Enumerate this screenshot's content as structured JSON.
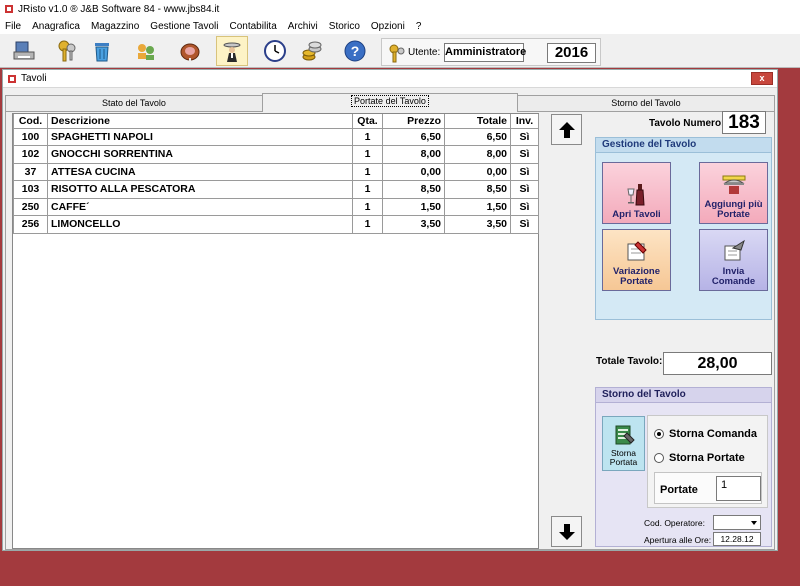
{
  "app": {
    "title": "JRisto v1.0 ® J&B Software 84 - www.jbs84.it"
  },
  "menu": [
    "File",
    "Anagrafica",
    "Magazzino",
    "Gestione Tavoli",
    "Contabilita",
    "Archivi",
    "Storico",
    "Opzioni",
    "?"
  ],
  "toolbar": {
    "icons": [
      "print-settings-icon",
      "keys-icon",
      "trash-icon",
      "people-icon",
      "ham-icon",
      "waiter-icon",
      "clock-icon",
      "coins-icon",
      "help-icon"
    ],
    "active_index": 5
  },
  "user": {
    "label": "Utente:",
    "name": "Amministratore",
    "year": "2016"
  },
  "window": {
    "title": "Tavoli",
    "close": "x"
  },
  "tabs": [
    {
      "label": "Stato del Tavolo",
      "selected": false
    },
    {
      "label": "Portate del Tavolo",
      "selected": true
    },
    {
      "label": "Storno del Tavolo",
      "selected": false
    }
  ],
  "table": {
    "headers": {
      "cod": "Cod.",
      "desc": "Descrizione",
      "qta": "Qta.",
      "prezzo": "Prezzo",
      "totale": "Totale",
      "inv": "Inv."
    },
    "rows": [
      {
        "cod": "100",
        "desc": "SPAGHETTI NAPOLI",
        "qta": "1",
        "prezzo": "6,50",
        "totale": "6,50",
        "inv": "Sì"
      },
      {
        "cod": "102",
        "desc": "GNOCCHI SORRENTINA",
        "qta": "1",
        "prezzo": "8,00",
        "totale": "8,00",
        "inv": "Sì"
      },
      {
        "cod": "37",
        "desc": "ATTESA CUCINA",
        "qta": "1",
        "prezzo": "0,00",
        "totale": "0,00",
        "inv": "Sì"
      },
      {
        "cod": "103",
        "desc": "RISOTTO ALLA PESCATORA",
        "qta": "1",
        "prezzo": "8,50",
        "totale": "8,50",
        "inv": "Sì"
      },
      {
        "cod": "250",
        "desc": "CAFFE´",
        "qta": "1",
        "prezzo": "1,50",
        "totale": "1,50",
        "inv": "Sì"
      },
      {
        "cod": "256",
        "desc": "LIMONCELLO",
        "qta": "1",
        "prezzo": "3,50",
        "totale": "3,50",
        "inv": "Sì"
      }
    ]
  },
  "tavolo": {
    "label": "Tavolo Numero:",
    "number": "183"
  },
  "gestione": {
    "title": "Gestione del Tavolo",
    "apri": "Apri Tavoli",
    "aggiungi": "Aggiungi più Portate",
    "variazione": "Variazione Portate",
    "invia": "Invia Comande"
  },
  "totale": {
    "label": "Totale Tavolo:",
    "value": "28,00"
  },
  "storno": {
    "title": "Storno del Tavolo",
    "button": "Storna Portata",
    "opt_comanda": "Storna Comanda",
    "opt_portate": "Storna Portate",
    "selected": "comanda",
    "portate_label": "Portate",
    "portate_value": "1",
    "operatore_label": "Cod. Operatore:",
    "operatore_value": "",
    "apertura_label": "Apertura alle Ore:",
    "apertura_value": "12.28.12"
  },
  "colors": {
    "background": "#a33a3e",
    "panel": "#f0f0f0",
    "gestione_bg": "#d4e9f5",
    "storno_bg": "#e6e4f4"
  }
}
